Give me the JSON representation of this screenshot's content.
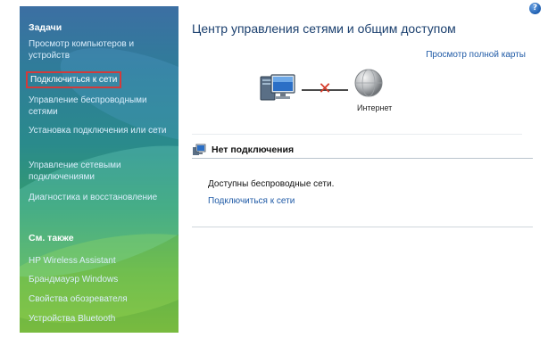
{
  "sidebar": {
    "tasks_heading": "Задачи",
    "tasks": [
      {
        "label": "Просмотр компьютеров и устройств"
      },
      {
        "label": "Подключиться к сети"
      },
      {
        "label": "Управление беспроводными сетями"
      },
      {
        "label": "Установка подключения или сети"
      },
      {
        "label": "Управление сетевыми подключениями"
      },
      {
        "label": "Диагностика и восстановление"
      }
    ],
    "see_also_heading": "См. также",
    "see_also": [
      {
        "label": "HP Wireless Assistant"
      },
      {
        "label": "Брандмауэр Windows"
      },
      {
        "label": "Свойства обозревателя"
      },
      {
        "label": "Устройства Bluetooth"
      }
    ]
  },
  "main": {
    "help_icon_glyph": "?",
    "title": "Центр управления сетями и общим доступом",
    "full_map_link": "Просмотр полной карты",
    "map": {
      "computer_icon": "computer-icon",
      "status_glyph": "✕",
      "globe_icon": "globe-icon",
      "internet_label": "Интернет"
    },
    "status": {
      "icon": "network-icon",
      "heading": "Нет подключения"
    },
    "available_text": "Доступны беспроводные сети.",
    "connect_link": "Подключиться к сети"
  },
  "colors": {
    "sidebar_top": "#3c6fa3",
    "sidebar_bottom": "#79bb3f",
    "link": "#1f5aa6",
    "title": "#1a3f6e",
    "highlight_border": "#d23b3b",
    "disconnect_x": "#d63b2a"
  }
}
